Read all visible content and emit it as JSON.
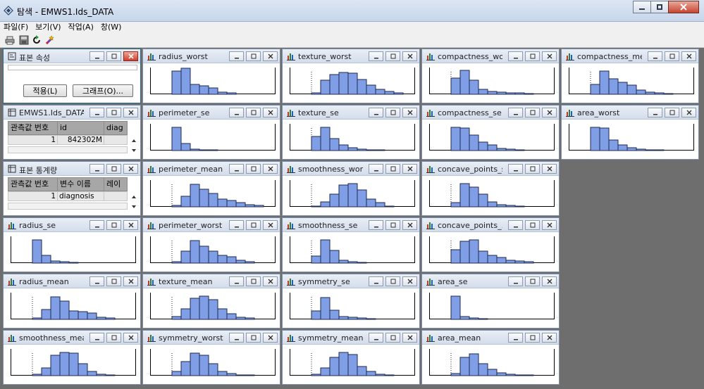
{
  "window": {
    "title": "탐색 - EMWS1.Ids_DATA",
    "menu": [
      "파일(F)",
      "보기(V)",
      "작업(A)",
      "창(W)"
    ],
    "toolbar_icons": [
      "print-icon",
      "save-icon",
      "refresh-icon",
      "wizard-icon"
    ]
  },
  "control_panels": {
    "properties": {
      "title": "표본 속성",
      "apply_label": "적용(L)",
      "graph_label": "그래프(O)..."
    },
    "data_table": {
      "title": "EMWS1.Ids_DATA",
      "columns": [
        "관측값 번호",
        "id",
        "diag"
      ],
      "row": [
        "1",
        "842302M",
        ""
      ]
    },
    "stats_table": {
      "title": "표본 통계량",
      "columns": [
        "관측값 번호",
        "변수 이름",
        "레이"
      ],
      "row": [
        "1",
        "diagnosis",
        ""
      ]
    }
  },
  "chart_data": [
    {
      "type": "bar",
      "title": "radius_worst",
      "values": [
        0,
        30,
        34,
        13,
        11,
        8,
        3,
        2,
        0
      ]
    },
    {
      "type": "bar",
      "title": "texture_worst",
      "values": [
        0,
        2,
        18,
        25,
        28,
        27,
        19,
        12,
        6,
        4,
        2
      ]
    },
    {
      "type": "bar",
      "title": "compactness_wo...",
      "values": [
        0,
        21,
        31,
        18,
        6,
        4,
        3,
        2,
        2,
        1
      ]
    },
    {
      "type": "bar",
      "title": "compactness_me...",
      "values": [
        0,
        13,
        30,
        20,
        15,
        12,
        5,
        3,
        2,
        1
      ]
    },
    {
      "type": "bar",
      "title": "perimeter_se",
      "values": [
        0,
        30,
        9,
        2,
        1,
        1,
        0,
        0,
        0
      ]
    },
    {
      "type": "bar",
      "title": "texture_se",
      "values": [
        0,
        18,
        30,
        15,
        7,
        4,
        2,
        1,
        1
      ]
    },
    {
      "type": "bar",
      "title": "compactness_se",
      "values": [
        0,
        30,
        29,
        20,
        11,
        7,
        3,
        2,
        1
      ]
    },
    {
      "type": "bar",
      "title": "area_worst",
      "values": [
        0,
        30,
        29,
        14,
        7,
        4,
        2,
        1,
        1
      ]
    },
    {
      "type": "bar",
      "title": "perimeter_mean",
      "values": [
        0,
        2,
        14,
        29,
        23,
        17,
        10,
        8,
        5,
        3,
        2
      ]
    },
    {
      "type": "bar",
      "title": "smoothness_worst",
      "values": [
        0,
        1,
        6,
        16,
        28,
        30,
        22,
        10,
        5,
        1
      ]
    },
    {
      "type": "bar",
      "title": "concave_points_se",
      "values": [
        0,
        5,
        30,
        25,
        16,
        6,
        3,
        2,
        1
      ]
    },
    {
      "type": "bar",
      "title": "radius_se",
      "values": [
        0,
        30,
        10,
        3,
        2,
        1,
        0,
        0,
        0
      ]
    },
    {
      "type": "bar",
      "title": "perimeter_worst",
      "values": [
        0,
        2,
        15,
        29,
        22,
        15,
        10,
        8,
        4,
        2
      ]
    },
    {
      "type": "bar",
      "title": "smoothness_se",
      "values": [
        0,
        9,
        30,
        16,
        4,
        2,
        1,
        0,
        0
      ]
    },
    {
      "type": "bar",
      "title": "concave_points_...",
      "values": [
        0,
        17,
        28,
        30,
        15,
        10,
        7,
        4,
        3,
        2
      ]
    },
    {
      "type": "bar",
      "title": "radius_mean",
      "values": [
        0,
        2,
        13,
        29,
        24,
        11,
        10,
        8,
        3,
        2
      ]
    },
    {
      "type": "bar",
      "title": "texture_mean",
      "values": [
        0,
        4,
        14,
        27,
        30,
        25,
        14,
        7,
        3,
        2
      ]
    },
    {
      "type": "bar",
      "title": "symmetry_se",
      "values": [
        0,
        11,
        28,
        12,
        4,
        3,
        2,
        1,
        0
      ]
    },
    {
      "type": "bar",
      "title": "area_se",
      "values": [
        0,
        30,
        4,
        2,
        1,
        0,
        0,
        0,
        0
      ]
    },
    {
      "type": "bar",
      "title": "smoothness_mean",
      "values": [
        0,
        2,
        10,
        26,
        30,
        29,
        15,
        5,
        2,
        1
      ]
    },
    {
      "type": "bar",
      "title": "symmetry_worst",
      "values": [
        0,
        5,
        18,
        29,
        26,
        15,
        5,
        3,
        1,
        1
      ]
    },
    {
      "type": "bar",
      "title": "symmetry_mean",
      "values": [
        0,
        2,
        10,
        24,
        30,
        27,
        12,
        5,
        2,
        1
      ]
    },
    {
      "type": "bar",
      "title": "area_mean",
      "values": [
        0,
        3,
        24,
        28,
        15,
        8,
        4,
        2,
        1,
        1
      ]
    }
  ]
}
